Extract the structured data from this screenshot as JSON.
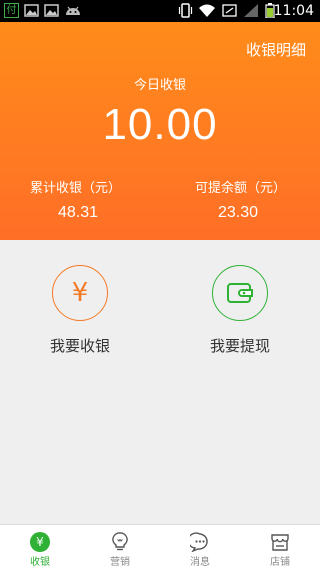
{
  "status_bar": {
    "time": "11:04",
    "app_notification_glyph": "付",
    "icons": [
      "wechat-pay-notification-icon",
      "image-icon",
      "android-icon",
      "vibrate-icon",
      "wifi-icon",
      "data-icon",
      "signal-icon",
      "battery-icon"
    ]
  },
  "header": {
    "detail_link": "收银明细",
    "today_label": "今日收银",
    "today_amount": "10.00",
    "total_label": "累计收银（元）",
    "total_value": "48.31",
    "withdrawable_label": "可提余额（元）",
    "withdrawable_value": "23.30"
  },
  "actions": {
    "collect": {
      "label": "我要收银",
      "icon": "yen-circle-icon",
      "color": "#f47a26",
      "glyph": "¥"
    },
    "withdraw": {
      "label": "我要提现",
      "icon": "wallet-circle-icon",
      "color": "#2eb135"
    }
  },
  "tabs": [
    {
      "label": "收银",
      "icon": "yen-tab-icon",
      "active": true,
      "glyph": "¥"
    },
    {
      "label": "营销",
      "icon": "lightbulb-icon",
      "active": false
    },
    {
      "label": "消息",
      "icon": "chat-bubble-icon",
      "active": false
    },
    {
      "label": "店铺",
      "icon": "store-icon",
      "active": false
    }
  ],
  "colors": {
    "header_orange": "#ff7a22",
    "accent_green": "#2eb135",
    "accent_orange": "#f47a26"
  }
}
